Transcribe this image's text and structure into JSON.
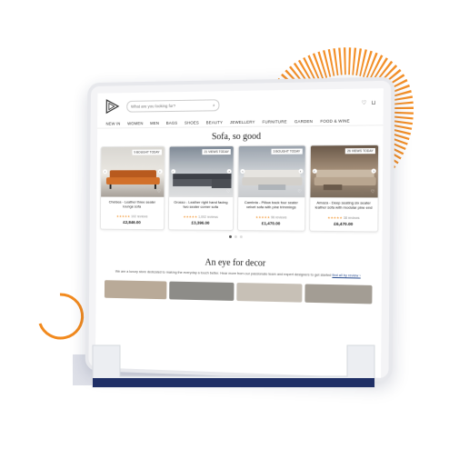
{
  "colors": {
    "accent": "#f28a1e",
    "navy": "#1f2f66",
    "price_star": "#f29a3a"
  },
  "header": {
    "logo_icon": "triangle-logo-icon",
    "search": {
      "placeholder": "What are you looking for?",
      "icon": "search-icon"
    },
    "icons": [
      "heart-icon",
      "cart-icon"
    ]
  },
  "nav": {
    "items": [
      "NEW IN",
      "WOMEN",
      "MEN",
      "BAGS",
      "SHOES",
      "BEAUTY",
      "JEWELLERY",
      "FURNITURE",
      "GARDEN",
      "FOOD & WINE"
    ]
  },
  "hero": {
    "title": "Sofa, so good"
  },
  "products": [
    {
      "badge": "9 BOUGHT TODAY",
      "title": "Chelsea - Leather three seater lounge sofa",
      "stars": "★★★★★",
      "reviews": "102 reviews",
      "price": "£2,846.00"
    },
    {
      "badge": "21 VIEWS TODAY",
      "title": "Grosso - Leather right hand facing two seater corner sofa",
      "stars": "★★★★★",
      "reviews": "1,002 reviews",
      "price": "£3,396.00"
    },
    {
      "badge": "3 BOUGHT TODAY",
      "title": "Cambria - Pillow back four seater velvet sofa with pine trimmings",
      "stars": "★★★★★",
      "reviews": "96 reviews",
      "price": "£1,470.00"
    },
    {
      "badge": "26 VIEWS TODAY",
      "title": "Amaza - Deep seating six seater leather sofa with modular pine end",
      "stars": "★★★★★",
      "reviews": "38 reviews",
      "price": "£6,470.00"
    }
  ],
  "carousel": {
    "dots": 3,
    "active": 0
  },
  "decor": {
    "title": "An eye for decor",
    "text": "We are a luxury store dedicated to making the everyday a touch better. Hear more from our passionate team and expert designers to get started",
    "link": "find all by review ›"
  }
}
